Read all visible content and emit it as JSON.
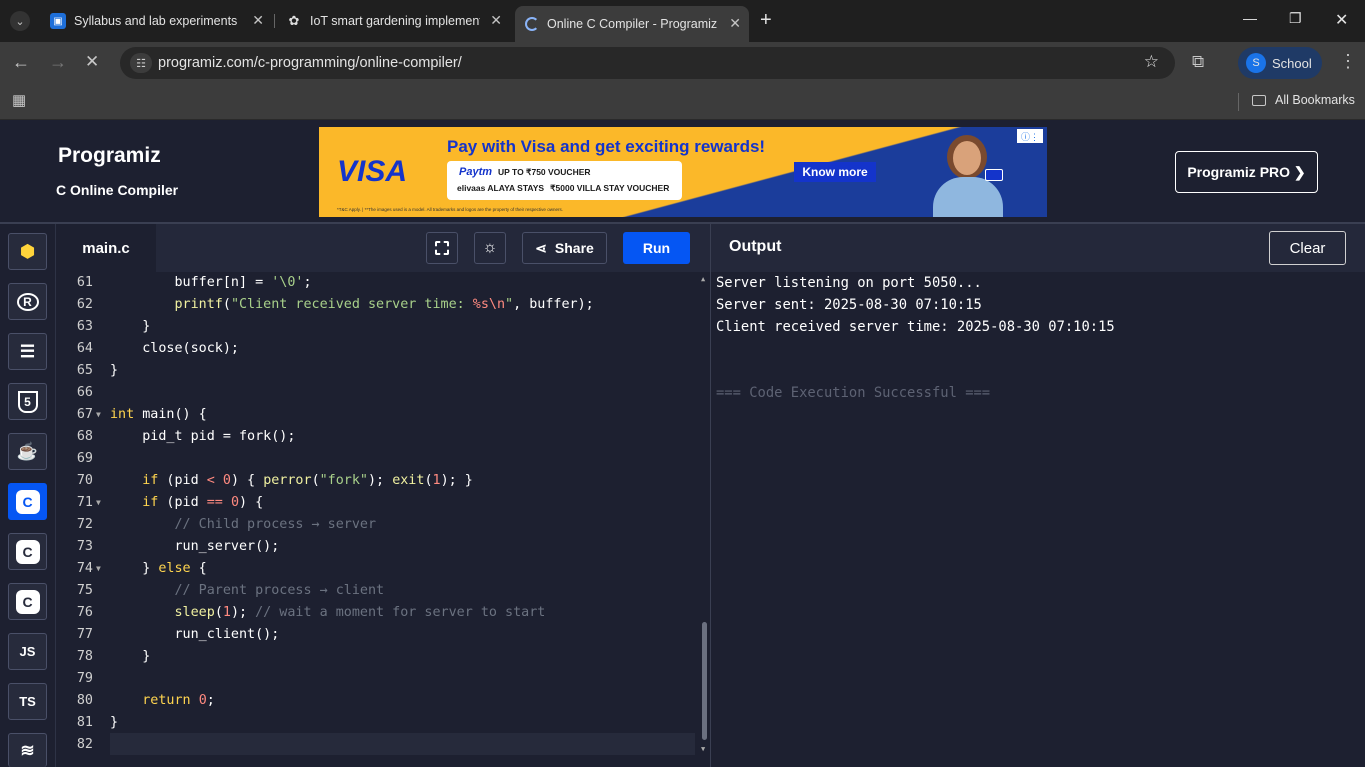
{
  "browser": {
    "tabs": [
      {
        "title": "Syllabus and lab experiments",
        "icon": "classroom-icon"
      },
      {
        "title": "IoT smart gardening implement",
        "icon": "openai-icon"
      },
      {
        "title": "Online C Compiler - Programiz",
        "icon": "programiz-icon"
      }
    ],
    "url": "programiz.com/c-programming/online-compiler/",
    "profile_label": "School",
    "profile_initial": "S",
    "bookmarks_label": "All Bookmarks"
  },
  "site": {
    "logo": "Programiz",
    "subtitle": "C Online Compiler",
    "pro_label": "Programiz PRO ❯",
    "ad": {
      "brand": "VISA",
      "headline": "Pay with Visa and get exciting rewards!",
      "line1_brand": "Paytm",
      "line1": "UP TO ₹750 VOUCHER",
      "line2": "₹5000 VILLA STAY VOUCHER",
      "line2_brands": "elivaas  ALAYA STAYS",
      "cta": "Know more",
      "disclaimer": "*T&C Apply. | **The images used is a model. All trademarks and logos are the property of their respective owners."
    }
  },
  "sidebar": {
    "languages": [
      {
        "name": "python-icon",
        "label": "",
        "active": false
      },
      {
        "name": "r-icon",
        "label": "R",
        "active": false
      },
      {
        "name": "sql-icon",
        "label": "",
        "active": false
      },
      {
        "name": "html-icon",
        "label": "5",
        "active": false
      },
      {
        "name": "java-icon",
        "label": "",
        "active": false
      },
      {
        "name": "c-icon",
        "label": "C",
        "active": true
      },
      {
        "name": "cpp-icon",
        "label": "C",
        "active": false
      },
      {
        "name": "csharp-icon",
        "label": "C",
        "active": false
      },
      {
        "name": "js-icon",
        "label": "JS",
        "active": false
      },
      {
        "name": "ts-icon",
        "label": "TS",
        "active": false
      },
      {
        "name": "swift-icon",
        "label": "",
        "active": false
      }
    ]
  },
  "editor": {
    "filename": "main.c",
    "share_label": "Share",
    "run_label": "Run",
    "lines": [
      {
        "n": "61",
        "fold": false,
        "html": "        buffer[n] = <span class='s'>'\\0'</span>;"
      },
      {
        "n": "62",
        "fold": false,
        "html": "        <span class='f'>printf</span>(<span class='s'>\"Client received server time: </span><span class='n'>%s\\n</span><span class='s'>\"</span>, buffer);"
      },
      {
        "n": "63",
        "fold": false,
        "html": "    }"
      },
      {
        "n": "64",
        "fold": false,
        "html": "    close(sock);"
      },
      {
        "n": "65",
        "fold": false,
        "html": "}"
      },
      {
        "n": "66",
        "fold": false,
        "html": ""
      },
      {
        "n": "67",
        "fold": true,
        "html": "<span class='k'>int</span> main() {"
      },
      {
        "n": "68",
        "fold": false,
        "html": "    pid_t pid = fork();"
      },
      {
        "n": "69",
        "fold": false,
        "html": ""
      },
      {
        "n": "70",
        "fold": false,
        "html": "    <span class='k'>if</span> (pid <span class='n'>&lt;</span> <span class='n'>0</span>) { <span class='f'>perror</span>(<span class='s'>\"fork\"</span>); <span class='f'>exit</span>(<span class='n'>1</span>); }"
      },
      {
        "n": "71",
        "fold": true,
        "html": "    <span class='k'>if</span> (pid <span class='n'>==</span> <span class='n'>0</span>) {"
      },
      {
        "n": "72",
        "fold": false,
        "html": "        <span class='c'>// Child process → server</span>"
      },
      {
        "n": "73",
        "fold": false,
        "html": "        run_server();"
      },
      {
        "n": "74",
        "fold": true,
        "html": "    } <span class='k'>else</span> {"
      },
      {
        "n": "75",
        "fold": false,
        "html": "        <span class='c'>// Parent process → client</span>"
      },
      {
        "n": "76",
        "fold": false,
        "html": "        <span class='f'>sleep</span>(<span class='n'>1</span>); <span class='c'>// wait a moment for server to start</span>"
      },
      {
        "n": "77",
        "fold": false,
        "html": "        run_client();"
      },
      {
        "n": "78",
        "fold": false,
        "html": "    }"
      },
      {
        "n": "79",
        "fold": false,
        "html": ""
      },
      {
        "n": "80",
        "fold": false,
        "html": "    <span class='k'>return</span> <span class='n'>0</span>;"
      },
      {
        "n": "81",
        "fold": false,
        "html": "}"
      },
      {
        "n": "82",
        "fold": false,
        "html": ""
      }
    ]
  },
  "output": {
    "title": "Output",
    "clear_label": "Clear",
    "lines": [
      {
        "text": "Server listening on port 5050...",
        "muted": false
      },
      {
        "text": "Server sent: 2025-08-30 07:10:15",
        "muted": false
      },
      {
        "text": "Client received server time: 2025-08-30 07:10:15",
        "muted": false
      },
      {
        "text": "",
        "muted": false
      },
      {
        "text": "",
        "muted": false
      },
      {
        "text": "=== Code Execution Successful ===",
        "muted": true
      }
    ]
  },
  "colors": {
    "accent": "#0556f3",
    "background": "#1d2030"
  }
}
